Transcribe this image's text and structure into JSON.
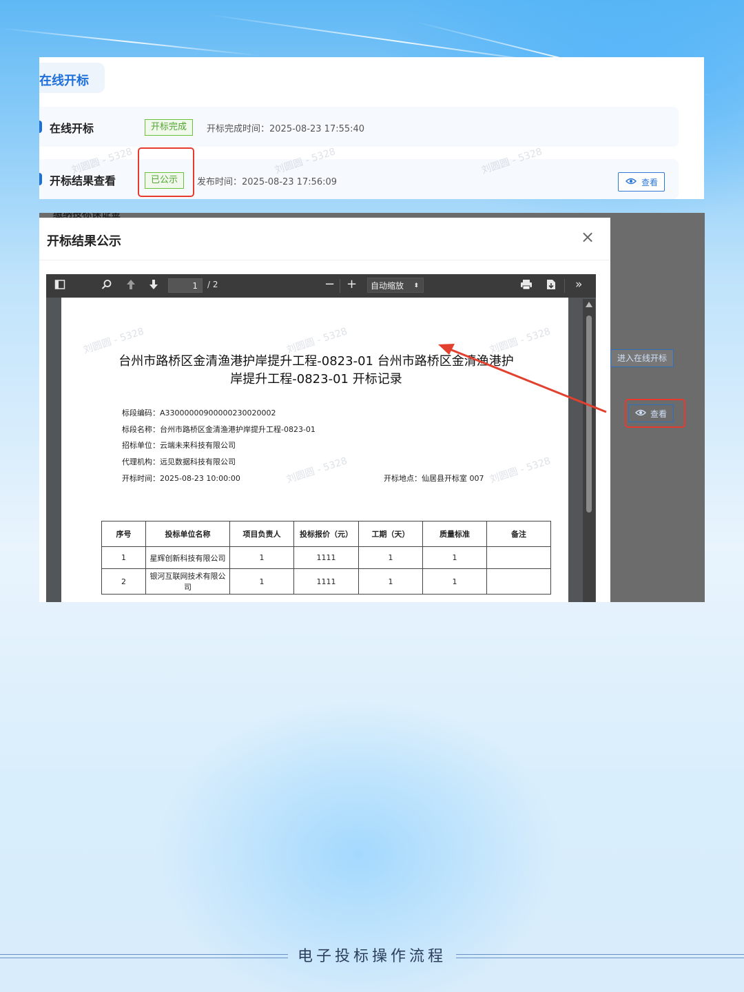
{
  "top_panel": {
    "tab_label": "在线开标",
    "rows": [
      {
        "title": "在线开标",
        "tag": "开标完成",
        "time_text": "开标完成时间：2025-08-23 17:55:40"
      },
      {
        "title": "开标结果查看",
        "tag": "已公示",
        "time_text": "发布时间：2025-08-23 17:56:09",
        "view_label": "查看"
      }
    ],
    "watermark": "刘圆圆 - 5328"
  },
  "lower": {
    "peek_text": "缴纳投标保证金",
    "enter_button": "进入在线开标",
    "view_label": "查看"
  },
  "modal": {
    "title": "开标结果公示",
    "close": "×"
  },
  "pdf_toolbar": {
    "page_current": "1",
    "page_total": "/ 2",
    "zoom": "自动缩放"
  },
  "document": {
    "title_line1": "台州市路桥区金清渔港护岸提升工程-0823-01 台州市路桥区金清渔港护",
    "title_line2": "岸提升工程-0823-01 开标记录",
    "code": "标段编码：A33000000900000230020002",
    "name": "标段名称：台州市路桥区金清渔港护岸提升工程-0823-01",
    "tenderer": "招标单位：云端未来科技有限公司",
    "agency": "代理机构：远见数据科技有限公司",
    "open_time": "开标时间：2025-08-23  10:00:00",
    "open_place": "开标地点：仙居县开标室 007",
    "table": {
      "headers": [
        "序号",
        "投标单位名称",
        "项目负责人",
        "投标报价（元）",
        "工期（天）",
        "质量标准",
        "备注"
      ],
      "rows": [
        [
          "1",
          "星辉创新科技有限公司",
          "1",
          "1111",
          "1",
          "1",
          ""
        ],
        [
          "2",
          "银河互联网技术有限公司",
          "1",
          "1111",
          "1",
          "1",
          ""
        ]
      ]
    }
  },
  "footer": {
    "text": "电子投标操作流程"
  }
}
